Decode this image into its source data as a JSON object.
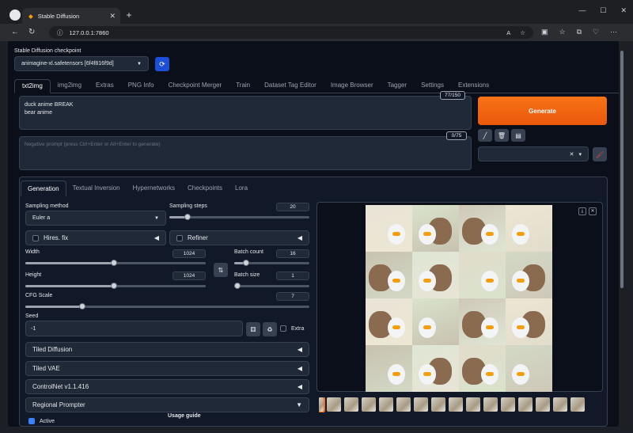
{
  "browser": {
    "tab_title": "Stable Diffusion",
    "url": "127.0.0.1:7860"
  },
  "checkpoint": {
    "label": "Stable Diffusion checkpoint",
    "value": "animagine-xl.safetensors [6f4f816f9d]"
  },
  "main_tabs": [
    "txt2img",
    "img2img",
    "Extras",
    "PNG Info",
    "Checkpoint Merger",
    "Train",
    "Dataset Tag Editor",
    "Image Browser",
    "Tagger",
    "Settings",
    "Extensions"
  ],
  "prompt": {
    "text": "duck anime BREAK\nbear anime",
    "token_count": "77/150",
    "negative_placeholder": "Negative prompt (press Ctrl+Enter or Alt+Enter to generate)",
    "negative_token_count": "0/75"
  },
  "generate_label": "Generate",
  "sub_tabs": [
    "Generation",
    "Textual Inversion",
    "Hypernetworks",
    "Checkpoints",
    "Lora"
  ],
  "generation": {
    "sampling_method_label": "Sampling method",
    "sampling_method": "Euler a",
    "sampling_steps_label": "Sampling steps",
    "sampling_steps": "20",
    "hires_label": "Hires. fix",
    "refiner_label": "Refiner",
    "width_label": "Width",
    "width": "1024",
    "height_label": "Height",
    "height": "1024",
    "batch_count_label": "Batch count",
    "batch_count": "16",
    "batch_size_label": "Batch size",
    "batch_size": "1",
    "cfg_label": "CFG Scale",
    "cfg": "7",
    "seed_label": "Seed",
    "seed": "-1",
    "extra_label": "Extra"
  },
  "slider_fractions": {
    "sampling_steps": 0.13,
    "width": 0.49,
    "height": 0.49,
    "batch_count": 0.16,
    "batch_size": 0.0,
    "cfg": 0.2
  },
  "accordions": [
    "Tiled Diffusion",
    "Tiled VAE",
    "ControlNet v1.1.416"
  ],
  "regional": {
    "label": "Regional Prompter",
    "usage_guide": "Usage guide",
    "active_label": "Active"
  },
  "colors": {
    "accent": "#f97316",
    "panel_bg": "#111827",
    "app_bg": "#0b0f19"
  }
}
